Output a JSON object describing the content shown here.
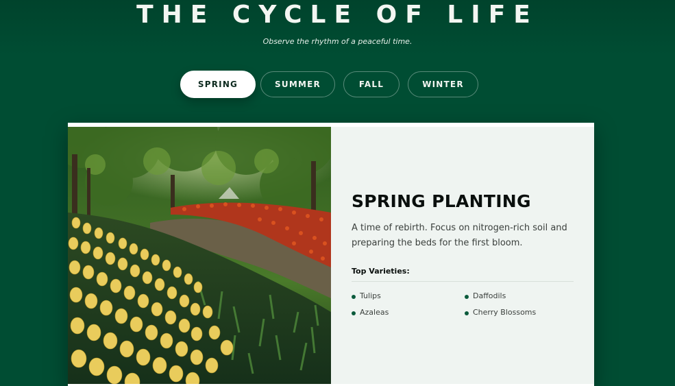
{
  "header": {
    "title": "THE CYCLE OF LIFE",
    "subtitle": "Observe the rhythm of a peaceful time."
  },
  "tabs": [
    {
      "label": "SPRING",
      "active": true
    },
    {
      "label": "SUMMER",
      "active": false
    },
    {
      "label": "FALL",
      "active": false
    },
    {
      "label": "WINTER",
      "active": false
    }
  ],
  "card": {
    "heading": "SPRING PLANTING",
    "description": "A time of rebirth. Focus on nitrogen-rich soil and preparing the beds for the first bloom.",
    "varieties_label": "Top Varieties:",
    "varieties": [
      "Tulips",
      "Daffodils",
      "Azaleas",
      "Cherry Blossoms"
    ]
  },
  "colors": {
    "background": "#004d33",
    "accent": "#0b5b3c",
    "card_panel": "#eff4f1"
  }
}
